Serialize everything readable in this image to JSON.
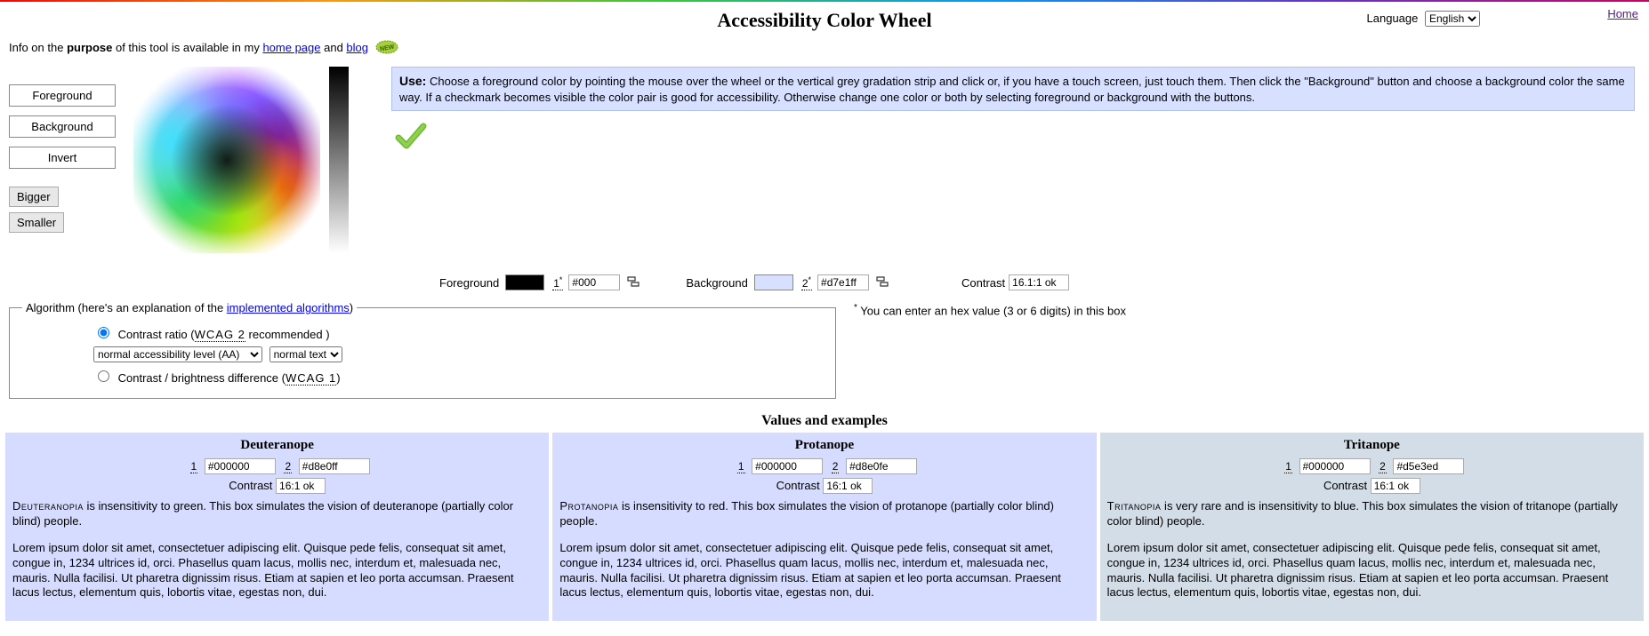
{
  "header": {
    "title": "Accessibility Color Wheel",
    "language_label": "Language",
    "language_value": "English",
    "home_link": "Home"
  },
  "intro": {
    "prefix": "Info on the ",
    "bold": "purpose",
    "mid": " of this tool is available in my ",
    "homepage": "home page",
    "and": " and ",
    "blog": "blog"
  },
  "buttons": {
    "foreground": "Foreground",
    "background": "Background",
    "invert": "Invert",
    "bigger": "Bigger",
    "smaller": "Smaller"
  },
  "use": {
    "label": "Use:",
    "text": "Choose a foreground color by pointing the mouse over the wheel or the vertical grey gradation strip and click or, if you have a touch screen, just touch them. Then click the \"Background\" button and choose a background color the same way. If a checkmark becomes visible the color pair is good for accessibility. Otherwise change one color or both by selecting foreground or background with the buttons."
  },
  "inputs": {
    "fg_label": "Foreground",
    "fg_hex": "#000",
    "bg_label": "Background",
    "bg_hex": "#d7e1ff",
    "contrast_label": "Contrast",
    "contrast_value": "16.1:1 ok",
    "num1": "1",
    "num2": "2",
    "star": "*"
  },
  "algorithm": {
    "legend_prefix": "Algorithm (here's an explanation of the ",
    "legend_link": "implemented algorithms",
    "legend_suffix": ")",
    "opt1_prefix": "Contrast ratio (",
    "opt1_abbr": "WCAG 2",
    "opt1_suffix": " recommended )",
    "level_select": "normal accessibility level (AA)",
    "text_select": "normal text",
    "opt2_prefix": "Contrast / brightness difference (",
    "opt2_abbr": "WCAG 1",
    "opt2_suffix": ")"
  },
  "footnote": "You can enter an hex value (3 or 6 digits) in this box",
  "examples_title": "Values and examples",
  "lorem": "Lorem ipsum dolor sit amet, consectetuer adipiscing elit. Quisque pede felis, consequat sit amet, congue in, 1234 ultrices id, orci. Phasellus quam lacus, mollis nec, interdum et, malesuada nec, mauris. Nulla facilisi. Ut pharetra dignissim risus. Etiam at sapien et leo porta accumsan. Praesent lacus lectus, elementum quis, lobortis vitae, egestas non, dui.",
  "examples": {
    "deut": {
      "title": "Deuteranope",
      "v1": "#000000",
      "v2": "#d8e0ff",
      "contrast": "16:1 ok",
      "term": "Deuteranopia",
      "desc": " is insensitivity to green. This box simulates the vision of deuteranope (partially color blind) people."
    },
    "prot": {
      "title": "Protanope",
      "v1": "#000000",
      "v2": "#d8e0fe",
      "contrast": "16:1 ok",
      "term": "Protanopia",
      "desc": " is insensitivity to red. This box simulates the vision of protanope (partially color blind) people."
    },
    "trit": {
      "title": "Tritanope",
      "v1": "#000000",
      "v2": "#d5e3ed",
      "contrast": "16:1 ok",
      "term": "Tritanopia",
      "desc": " is very rare and is insensitivity to blue. This box simulates the vision of tritanope (partially color blind) people."
    }
  }
}
